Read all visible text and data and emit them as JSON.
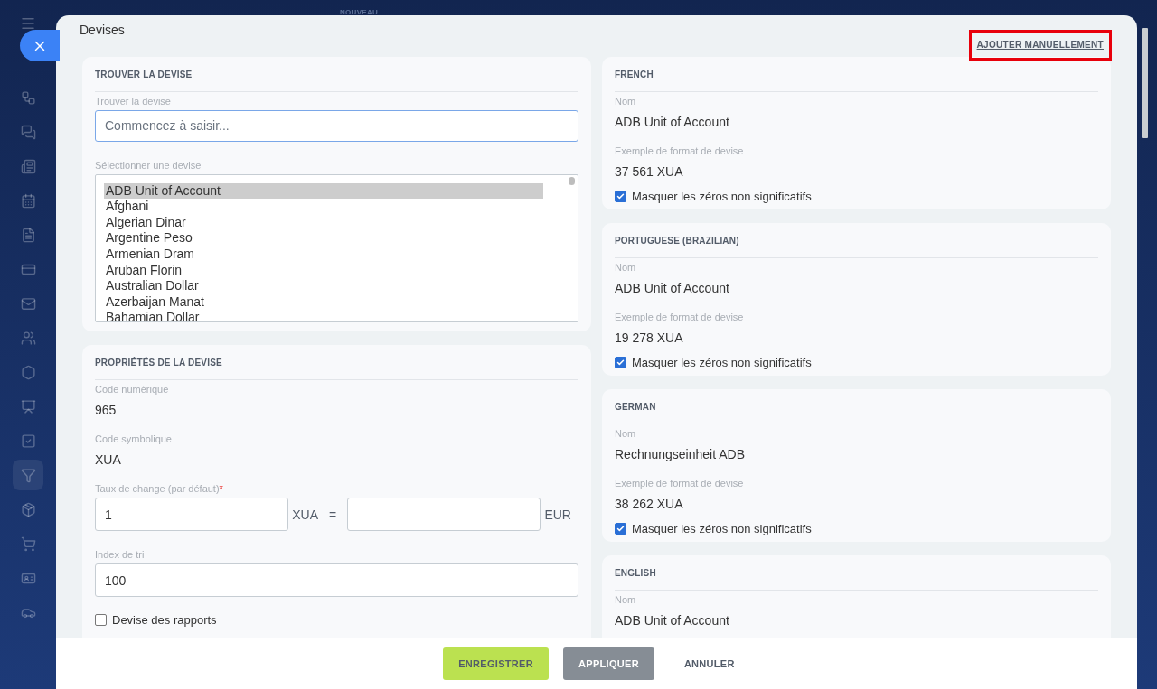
{
  "top_label": "NOUVEAU",
  "sidebar": {
    "items": [
      {
        "kind": "flow",
        "selected": false
      },
      {
        "kind": "chat",
        "selected": false
      },
      {
        "kind": "news",
        "selected": false
      },
      {
        "kind": "calendar",
        "selected": false
      },
      {
        "kind": "document",
        "selected": false
      },
      {
        "kind": "card",
        "selected": false
      },
      {
        "kind": "mail",
        "selected": false
      },
      {
        "kind": "people",
        "selected": false
      },
      {
        "kind": "hexagon",
        "selected": false
      },
      {
        "kind": "board",
        "selected": false
      },
      {
        "kind": "task",
        "selected": false
      },
      {
        "kind": "funnel",
        "selected": true
      },
      {
        "kind": "box",
        "selected": false
      },
      {
        "kind": "cart",
        "selected": false
      },
      {
        "kind": "id",
        "selected": false
      },
      {
        "kind": "car",
        "selected": false
      }
    ]
  },
  "window": {
    "title": "Devises",
    "action_link": "AJOUTER MANUELLEMENT"
  },
  "find_section": {
    "heading": "TROUVER LA DEVISE",
    "search_label": "Trouver la devise",
    "search_placeholder": "Commencez à saisir...",
    "list_label": "Sélectionner une devise",
    "currencies": [
      {
        "name": "ADB Unit of Account",
        "selected": true
      },
      {
        "name": "Afghani",
        "selected": false
      },
      {
        "name": "Algerian Dinar",
        "selected": false
      },
      {
        "name": "Argentine Peso",
        "selected": false
      },
      {
        "name": "Armenian Dram",
        "selected": false
      },
      {
        "name": "Aruban Florin",
        "selected": false
      },
      {
        "name": "Australian Dollar",
        "selected": false
      },
      {
        "name": "Azerbaijan Manat",
        "selected": false
      },
      {
        "name": "Bahamian Dollar",
        "selected": false
      }
    ]
  },
  "properties": {
    "heading": "PROPRIÉTÉS DE LA DEVISE",
    "numeric_code": {
      "label": "Code numérique",
      "value": "965"
    },
    "symbolic_code": {
      "label": "Code symbolique",
      "value": "XUA"
    },
    "rate": {
      "label": "Taux de change (par défaut)",
      "required_mark": "*",
      "amount": "1",
      "unit": "XUA",
      "equals": "=",
      "unit2": "EUR"
    },
    "sort": {
      "label": "Index de tri",
      "value": "100"
    },
    "report_currency": {
      "label": "Devise des rapports",
      "checked": false
    }
  },
  "languages": [
    {
      "heading": "FRENCH",
      "name_label": "Nom",
      "name": "ADB Unit of Account",
      "format_label": "Exemple de format de devise",
      "format": "37 561 XUA",
      "hide_zeros": "Masquer les zéros non significatifs",
      "checked": true
    },
    {
      "heading": "PORTUGUESE (BRAZILIAN)",
      "name_label": "Nom",
      "name": "ADB Unit of Account",
      "format_label": "Exemple de format de devise",
      "format": "19 278 XUA",
      "hide_zeros": "Masquer les zéros non significatifs",
      "checked": true
    },
    {
      "heading": "GERMAN",
      "name_label": "Nom",
      "name": "Rechnungseinheit ADB",
      "format_label": "Exemple de format de devise",
      "format": "38 262 XUA",
      "hide_zeros": "Masquer les zéros non significatifs",
      "checked": true
    },
    {
      "heading": "ENGLISH",
      "name_label": "Nom",
      "name": "ADB Unit of Account"
    }
  ],
  "buttons": [
    {
      "kind": "save",
      "label": "ENREGISTRER"
    },
    {
      "kind": "apply",
      "label": "APPLIQUER"
    },
    {
      "kind": "cancel",
      "label": "ANNULER"
    }
  ]
}
